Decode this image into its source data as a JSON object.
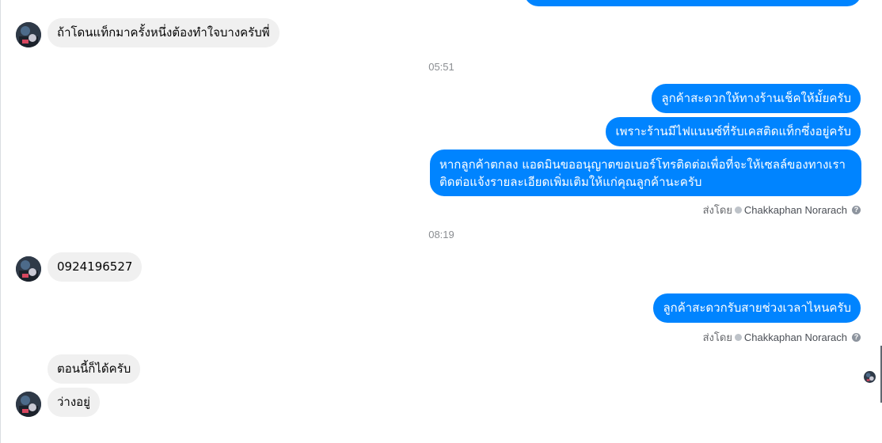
{
  "messages": {
    "incoming_1": "ถ้าโดนแท็กมาครั้งหนึ่งต้องทำใจบางครับพี่",
    "incoming_2": "0924196527",
    "incoming_3": "ตอนนี้ก็ได้ครับ",
    "incoming_4": "ว่างอยู่",
    "outgoing_1": "ลูกค้าสะดวกให้ทางร้านเช็คให้มั้ยครับ",
    "outgoing_2": "เพราะร้านมีไฟแนนซ์ที่รับเคสติดแท็กซึ่งอยู่ครับ",
    "outgoing_3_line1": "หากลูกค้าตกลง แอดมินขออนุญาตขอเบอร์โทรติดต่อเพื่อที่จะให้เซลล์ของทางเรา",
    "outgoing_3_line2": "ติดต่อแจ้งรายละเอียดเพิ่มเติมให้แก่คุณลูกค้านะครับ",
    "outgoing_4": "ลูกค้าสะดวกรับสายช่วงเวลาไหนครับ"
  },
  "timestamps": {
    "t1": "05:51",
    "t2": "08:19"
  },
  "sent_by": {
    "prefix": "ส่งโดย",
    "name": "Chakkaphan Norarach",
    "help": "?"
  },
  "icons": {
    "avatar": "contact-avatar-icon",
    "verified": "check-circle-icon",
    "help": "help-icon"
  },
  "colors": {
    "outgoing_bubble": "#0084ff",
    "incoming_bubble": "#f0f0f0"
  }
}
